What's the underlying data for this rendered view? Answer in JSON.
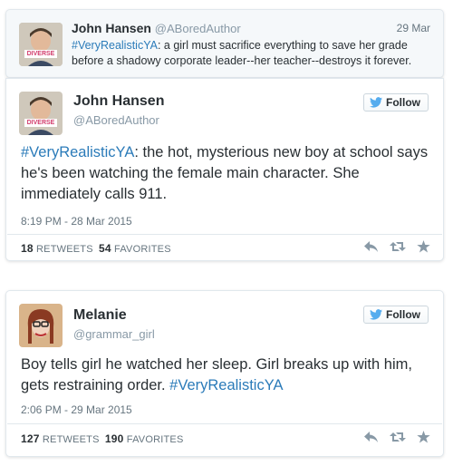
{
  "reply_tweet": {
    "name": "John Hansen",
    "handle": "@ABoredAuthor",
    "date": "29 Mar",
    "hashtag": "#VeryRealisticYA",
    "text": ": a girl must sacrifice everything to save her grade before a shadowy corporate leader--her teacher--destroys it forever.",
    "avatar_badge": "DIVERSE"
  },
  "tweet1": {
    "name": "John Hansen",
    "handle": "@ABoredAuthor",
    "follow_label": "Follow",
    "hashtag": "#VeryRealisticYA",
    "text": ": the hot, mysterious new boy at school says he's been watching the female main character. She immediately calls 911.",
    "timestamp": "8:19 PM - 28 Mar 2015",
    "retweets_count": "18",
    "retweets_label": "RETWEETS",
    "favorites_count": "54",
    "favorites_label": "FAVORITES",
    "avatar_badge": "DIVERSE"
  },
  "tweet2": {
    "name": "Melanie",
    "handle": "@grammar_girl",
    "follow_label": "Follow",
    "text": "Boy tells girl he watched her sleep. Girl breaks up with him, gets restraining order. ",
    "hashtag": "#VeryRealisticYA",
    "timestamp": "2:06 PM - 29 Mar 2015",
    "retweets_count": "127",
    "retweets_label": "RETWEETS",
    "favorites_count": "190",
    "favorites_label": "FAVORITES"
  },
  "colors": {
    "link": "#2b7bb9",
    "twitter_blue": "#55acee",
    "muted": "#8899a6"
  },
  "icons": [
    "reply-icon",
    "retweet-icon",
    "favorite-icon",
    "twitter-bird-icon"
  ]
}
